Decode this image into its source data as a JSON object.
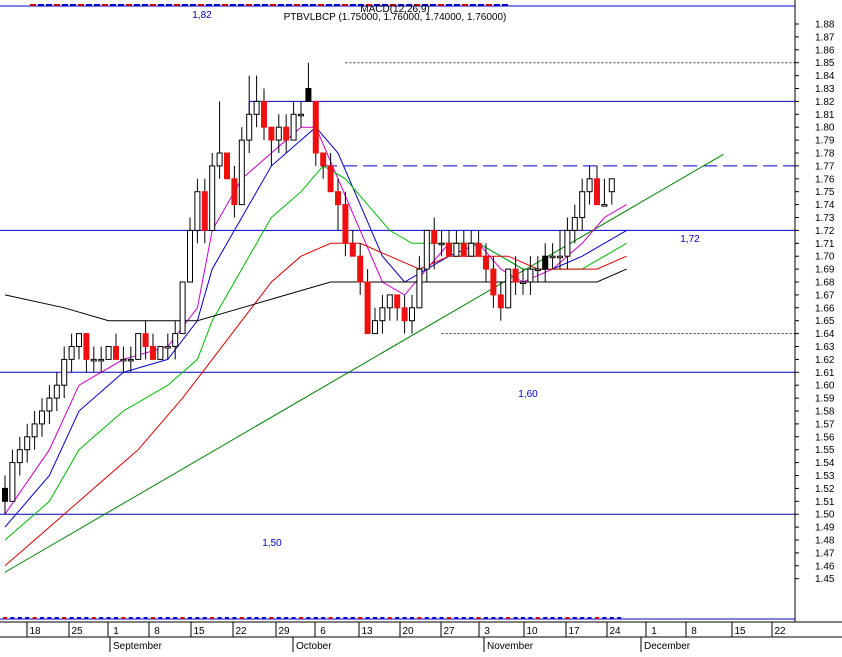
{
  "header": {
    "overlay_title": "MACD(12,26,9)",
    "symbol_line": "PTBVLBCP (1.75000, 1.76000, 1.74000, 1.76000)"
  },
  "colors": {
    "up_candle": "#ffffff",
    "down_candle": "#ee1111",
    "neutral_candle": "#000000",
    "level_line": "#0000cc",
    "trend_line": "#008000",
    "ma_fast": "#cc00cc",
    "ma_blue": "#0000cc",
    "ma_green": "#00bb00",
    "ma_red": "#dd0000",
    "ma_black": "#000000"
  },
  "chart_data": {
    "type": "candlestick",
    "title": "PTBVLBCP (1.75000, 1.76000, 1.74000, 1.76000)",
    "y_range": [
      1.44,
      1.89
    ],
    "y_ticks": [
      "1.45",
      "1.46",
      "1.47",
      "1.48",
      "1.49",
      "1.50",
      "1.51",
      "1.52",
      "1.53",
      "1.54",
      "1.55",
      "1.56",
      "1.57",
      "1.58",
      "1.59",
      "1.60",
      "1.61",
      "1.62",
      "1.63",
      "1.64",
      "1.65",
      "1.66",
      "1.67",
      "1.68",
      "1.69",
      "1.70",
      "1.71",
      "1.72",
      "1.73",
      "1.74",
      "1.75",
      "1.76",
      "1.77",
      "1.78",
      "1.79",
      "1.80",
      "1.81",
      "1.82",
      "1.83",
      "1.84",
      "1.85",
      "1.86",
      "1.87",
      "1.88"
    ],
    "x_day_labels": [
      "18",
      "25",
      "1",
      "8",
      "15",
      "22",
      "29",
      "6",
      "13",
      "20",
      "27",
      "3",
      "10",
      "17",
      "24",
      "1",
      "8",
      "15",
      "22"
    ],
    "x_month_labels": [
      "September",
      "October",
      "November",
      "December"
    ],
    "candles": [
      [
        1.52,
        1.53,
        1.5,
        1.51
      ],
      [
        1.51,
        1.55,
        1.51,
        1.54
      ],
      [
        1.54,
        1.56,
        1.53,
        1.55
      ],
      [
        1.55,
        1.57,
        1.54,
        1.56
      ],
      [
        1.56,
        1.58,
        1.55,
        1.57
      ],
      [
        1.57,
        1.59,
        1.56,
        1.58
      ],
      [
        1.58,
        1.6,
        1.57,
        1.59
      ],
      [
        1.59,
        1.61,
        1.58,
        1.6
      ],
      [
        1.6,
        1.63,
        1.59,
        1.62
      ],
      [
        1.62,
        1.64,
        1.61,
        1.63
      ],
      [
        1.63,
        1.64,
        1.62,
        1.64
      ],
      [
        1.64,
        1.64,
        1.61,
        1.62
      ],
      [
        1.62,
        1.63,
        1.61,
        1.62
      ],
      [
        1.62,
        1.63,
        1.61,
        1.62
      ],
      [
        1.62,
        1.63,
        1.62,
        1.63
      ],
      [
        1.63,
        1.64,
        1.62,
        1.62
      ],
      [
        1.62,
        1.63,
        1.61,
        1.62
      ],
      [
        1.62,
        1.63,
        1.61,
        1.62
      ],
      [
        1.62,
        1.64,
        1.62,
        1.64
      ],
      [
        1.64,
        1.65,
        1.62,
        1.63
      ],
      [
        1.63,
        1.64,
        1.62,
        1.62
      ],
      [
        1.62,
        1.63,
        1.62,
        1.63
      ],
      [
        1.63,
        1.64,
        1.62,
        1.63
      ],
      [
        1.63,
        1.65,
        1.62,
        1.64
      ],
      [
        1.64,
        1.68,
        1.64,
        1.68
      ],
      [
        1.68,
        1.73,
        1.68,
        1.72
      ],
      [
        1.72,
        1.76,
        1.71,
        1.75
      ],
      [
        1.75,
        1.76,
        1.71,
        1.72
      ],
      [
        1.72,
        1.78,
        1.72,
        1.77
      ],
      [
        1.77,
        1.82,
        1.76,
        1.78
      ],
      [
        1.78,
        1.78,
        1.76,
        1.76
      ],
      [
        1.76,
        1.77,
        1.73,
        1.74
      ],
      [
        1.74,
        1.8,
        1.74,
        1.79
      ],
      [
        1.79,
        1.84,
        1.78,
        1.81
      ],
      [
        1.81,
        1.84,
        1.8,
        1.82
      ],
      [
        1.82,
        1.83,
        1.79,
        1.8
      ],
      [
        1.8,
        1.8,
        1.77,
        1.79
      ],
      [
        1.79,
        1.81,
        1.78,
        1.8
      ],
      [
        1.8,
        1.81,
        1.78,
        1.79
      ],
      [
        1.79,
        1.82,
        1.79,
        1.81
      ],
      [
        1.81,
        1.82,
        1.8,
        1.81
      ],
      [
        1.83,
        1.85,
        1.82,
        1.82
      ],
      [
        1.82,
        1.82,
        1.77,
        1.78
      ],
      [
        1.78,
        1.78,
        1.76,
        1.77
      ],
      [
        1.77,
        1.78,
        1.75,
        1.75
      ],
      [
        1.75,
        1.76,
        1.72,
        1.74
      ],
      [
        1.74,
        1.75,
        1.7,
        1.71
      ],
      [
        1.71,
        1.72,
        1.7,
        1.7
      ],
      [
        1.7,
        1.71,
        1.67,
        1.68
      ],
      [
        1.68,
        1.69,
        1.64,
        1.64
      ],
      [
        1.64,
        1.66,
        1.64,
        1.65
      ],
      [
        1.65,
        1.67,
        1.64,
        1.66
      ],
      [
        1.66,
        1.67,
        1.65,
        1.67
      ],
      [
        1.67,
        1.67,
        1.65,
        1.66
      ],
      [
        1.66,
        1.67,
        1.64,
        1.65
      ],
      [
        1.65,
        1.67,
        1.64,
        1.66
      ],
      [
        1.66,
        1.7,
        1.66,
        1.69
      ],
      [
        1.69,
        1.72,
        1.68,
        1.72
      ],
      [
        1.72,
        1.73,
        1.69,
        1.71
      ],
      [
        1.71,
        1.72,
        1.7,
        1.71
      ],
      [
        1.71,
        1.72,
        1.7,
        1.7
      ],
      [
        1.7,
        1.72,
        1.7,
        1.71
      ],
      [
        1.71,
        1.72,
        1.7,
        1.7
      ],
      [
        1.7,
        1.72,
        1.7,
        1.71
      ],
      [
        1.71,
        1.72,
        1.7,
        1.7
      ],
      [
        1.7,
        1.71,
        1.68,
        1.69
      ],
      [
        1.69,
        1.7,
        1.66,
        1.67
      ],
      [
        1.67,
        1.68,
        1.65,
        1.66
      ],
      [
        1.66,
        1.69,
        1.66,
        1.69
      ],
      [
        1.69,
        1.7,
        1.67,
        1.68
      ],
      [
        1.68,
        1.69,
        1.67,
        1.68
      ],
      [
        1.68,
        1.7,
        1.67,
        1.69
      ],
      [
        1.69,
        1.7,
        1.68,
        1.69
      ],
      [
        1.69,
        1.71,
        1.68,
        1.7
      ],
      [
        1.7,
        1.71,
        1.69,
        1.7
      ],
      [
        1.7,
        1.72,
        1.69,
        1.7
      ],
      [
        1.7,
        1.73,
        1.69,
        1.72
      ],
      [
        1.72,
        1.74,
        1.71,
        1.73
      ],
      [
        1.73,
        1.76,
        1.72,
        1.75
      ],
      [
        1.75,
        1.77,
        1.74,
        1.76
      ],
      [
        1.76,
        1.77,
        1.74,
        1.74
      ],
      [
        1.74,
        1.76,
        1.74,
        1.74
      ],
      [
        1.75,
        1.76,
        1.74,
        1.76
      ]
    ],
    "moving_averages": [
      {
        "color": "#cc00cc",
        "points": [
          [
            0,
            1.5
          ],
          [
            6,
            1.55
          ],
          [
            10,
            1.6
          ],
          [
            16,
            1.62
          ],
          [
            22,
            1.63
          ],
          [
            26,
            1.66
          ],
          [
            28,
            1.72
          ],
          [
            32,
            1.76
          ],
          [
            36,
            1.78
          ],
          [
            40,
            1.8
          ],
          [
            42,
            1.8
          ],
          [
            45,
            1.76
          ],
          [
            48,
            1.72
          ],
          [
            51,
            1.68
          ],
          [
            54,
            1.67
          ],
          [
            57,
            1.69
          ],
          [
            60,
            1.71
          ],
          [
            64,
            1.71
          ],
          [
            67,
            1.69
          ],
          [
            70,
            1.68
          ],
          [
            74,
            1.69
          ],
          [
            78,
            1.71
          ],
          [
            81,
            1.73
          ],
          [
            84,
            1.74
          ]
        ]
      },
      {
        "color": "#0000cc",
        "points": [
          [
            0,
            1.49
          ],
          [
            6,
            1.53
          ],
          [
            10,
            1.58
          ],
          [
            16,
            1.61
          ],
          [
            22,
            1.62
          ],
          [
            26,
            1.65
          ],
          [
            28,
            1.69
          ],
          [
            32,
            1.73
          ],
          [
            36,
            1.77
          ],
          [
            40,
            1.79
          ],
          [
            42,
            1.8
          ],
          [
            45,
            1.78
          ],
          [
            48,
            1.74
          ],
          [
            51,
            1.7
          ],
          [
            54,
            1.68
          ],
          [
            57,
            1.69
          ],
          [
            60,
            1.7
          ],
          [
            64,
            1.71
          ],
          [
            67,
            1.7
          ],
          [
            70,
            1.69
          ],
          [
            74,
            1.69
          ],
          [
            78,
            1.7
          ],
          [
            81,
            1.71
          ],
          [
            84,
            1.72
          ]
        ]
      },
      {
        "color": "#00bb00",
        "points": [
          [
            0,
            1.48
          ],
          [
            6,
            1.51
          ],
          [
            10,
            1.55
          ],
          [
            16,
            1.58
          ],
          [
            22,
            1.6
          ],
          [
            26,
            1.62
          ],
          [
            28,
            1.65
          ],
          [
            32,
            1.69
          ],
          [
            36,
            1.73
          ],
          [
            40,
            1.75
          ],
          [
            43,
            1.77
          ],
          [
            46,
            1.76
          ],
          [
            49,
            1.74
          ],
          [
            52,
            1.72
          ],
          [
            55,
            1.71
          ],
          [
            58,
            1.71
          ],
          [
            61,
            1.71
          ],
          [
            64,
            1.71
          ],
          [
            67,
            1.7
          ],
          [
            70,
            1.69
          ],
          [
            74,
            1.69
          ],
          [
            78,
            1.69
          ],
          [
            81,
            1.7
          ],
          [
            84,
            1.71
          ]
        ]
      },
      {
        "color": "#dd0000",
        "points": [
          [
            0,
            1.46
          ],
          [
            6,
            1.49
          ],
          [
            12,
            1.52
          ],
          [
            18,
            1.55
          ],
          [
            24,
            1.59
          ],
          [
            28,
            1.62
          ],
          [
            32,
            1.65
          ],
          [
            36,
            1.68
          ],
          [
            40,
            1.7
          ],
          [
            44,
            1.71
          ],
          [
            48,
            1.71
          ],
          [
            52,
            1.7
          ],
          [
            56,
            1.69
          ],
          [
            60,
            1.7
          ],
          [
            64,
            1.7
          ],
          [
            68,
            1.7
          ],
          [
            72,
            1.69
          ],
          [
            76,
            1.69
          ],
          [
            80,
            1.69
          ],
          [
            84,
            1.7
          ]
        ]
      },
      {
        "color": "#000000",
        "points": [
          [
            0,
            1.67
          ],
          [
            8,
            1.66
          ],
          [
            14,
            1.65
          ],
          [
            20,
            1.65
          ],
          [
            26,
            1.65
          ],
          [
            32,
            1.66
          ],
          [
            38,
            1.67
          ],
          [
            44,
            1.68
          ],
          [
            50,
            1.68
          ],
          [
            56,
            1.68
          ],
          [
            62,
            1.68
          ],
          [
            68,
            1.68
          ],
          [
            74,
            1.68
          ],
          [
            80,
            1.68
          ],
          [
            84,
            1.69
          ]
        ]
      }
    ],
    "horizontal_levels": [
      {
        "value": 1.82,
        "label": "1,82",
        "style": "solid"
      },
      {
        "value": 1.77,
        "label": "",
        "style": "dashed"
      },
      {
        "value": 1.72,
        "label": "1,72",
        "style": "solid"
      },
      {
        "value": 1.61,
        "label": "1,60",
        "style": "solid"
      },
      {
        "value": 1.5,
        "label": "1,50",
        "style": "solid"
      }
    ],
    "dotted_levels": [
      1.85,
      1.64
    ],
    "trend_line": {
      "from": [
        0,
        1.455
      ],
      "to": [
        96,
        1.779
      ]
    }
  }
}
